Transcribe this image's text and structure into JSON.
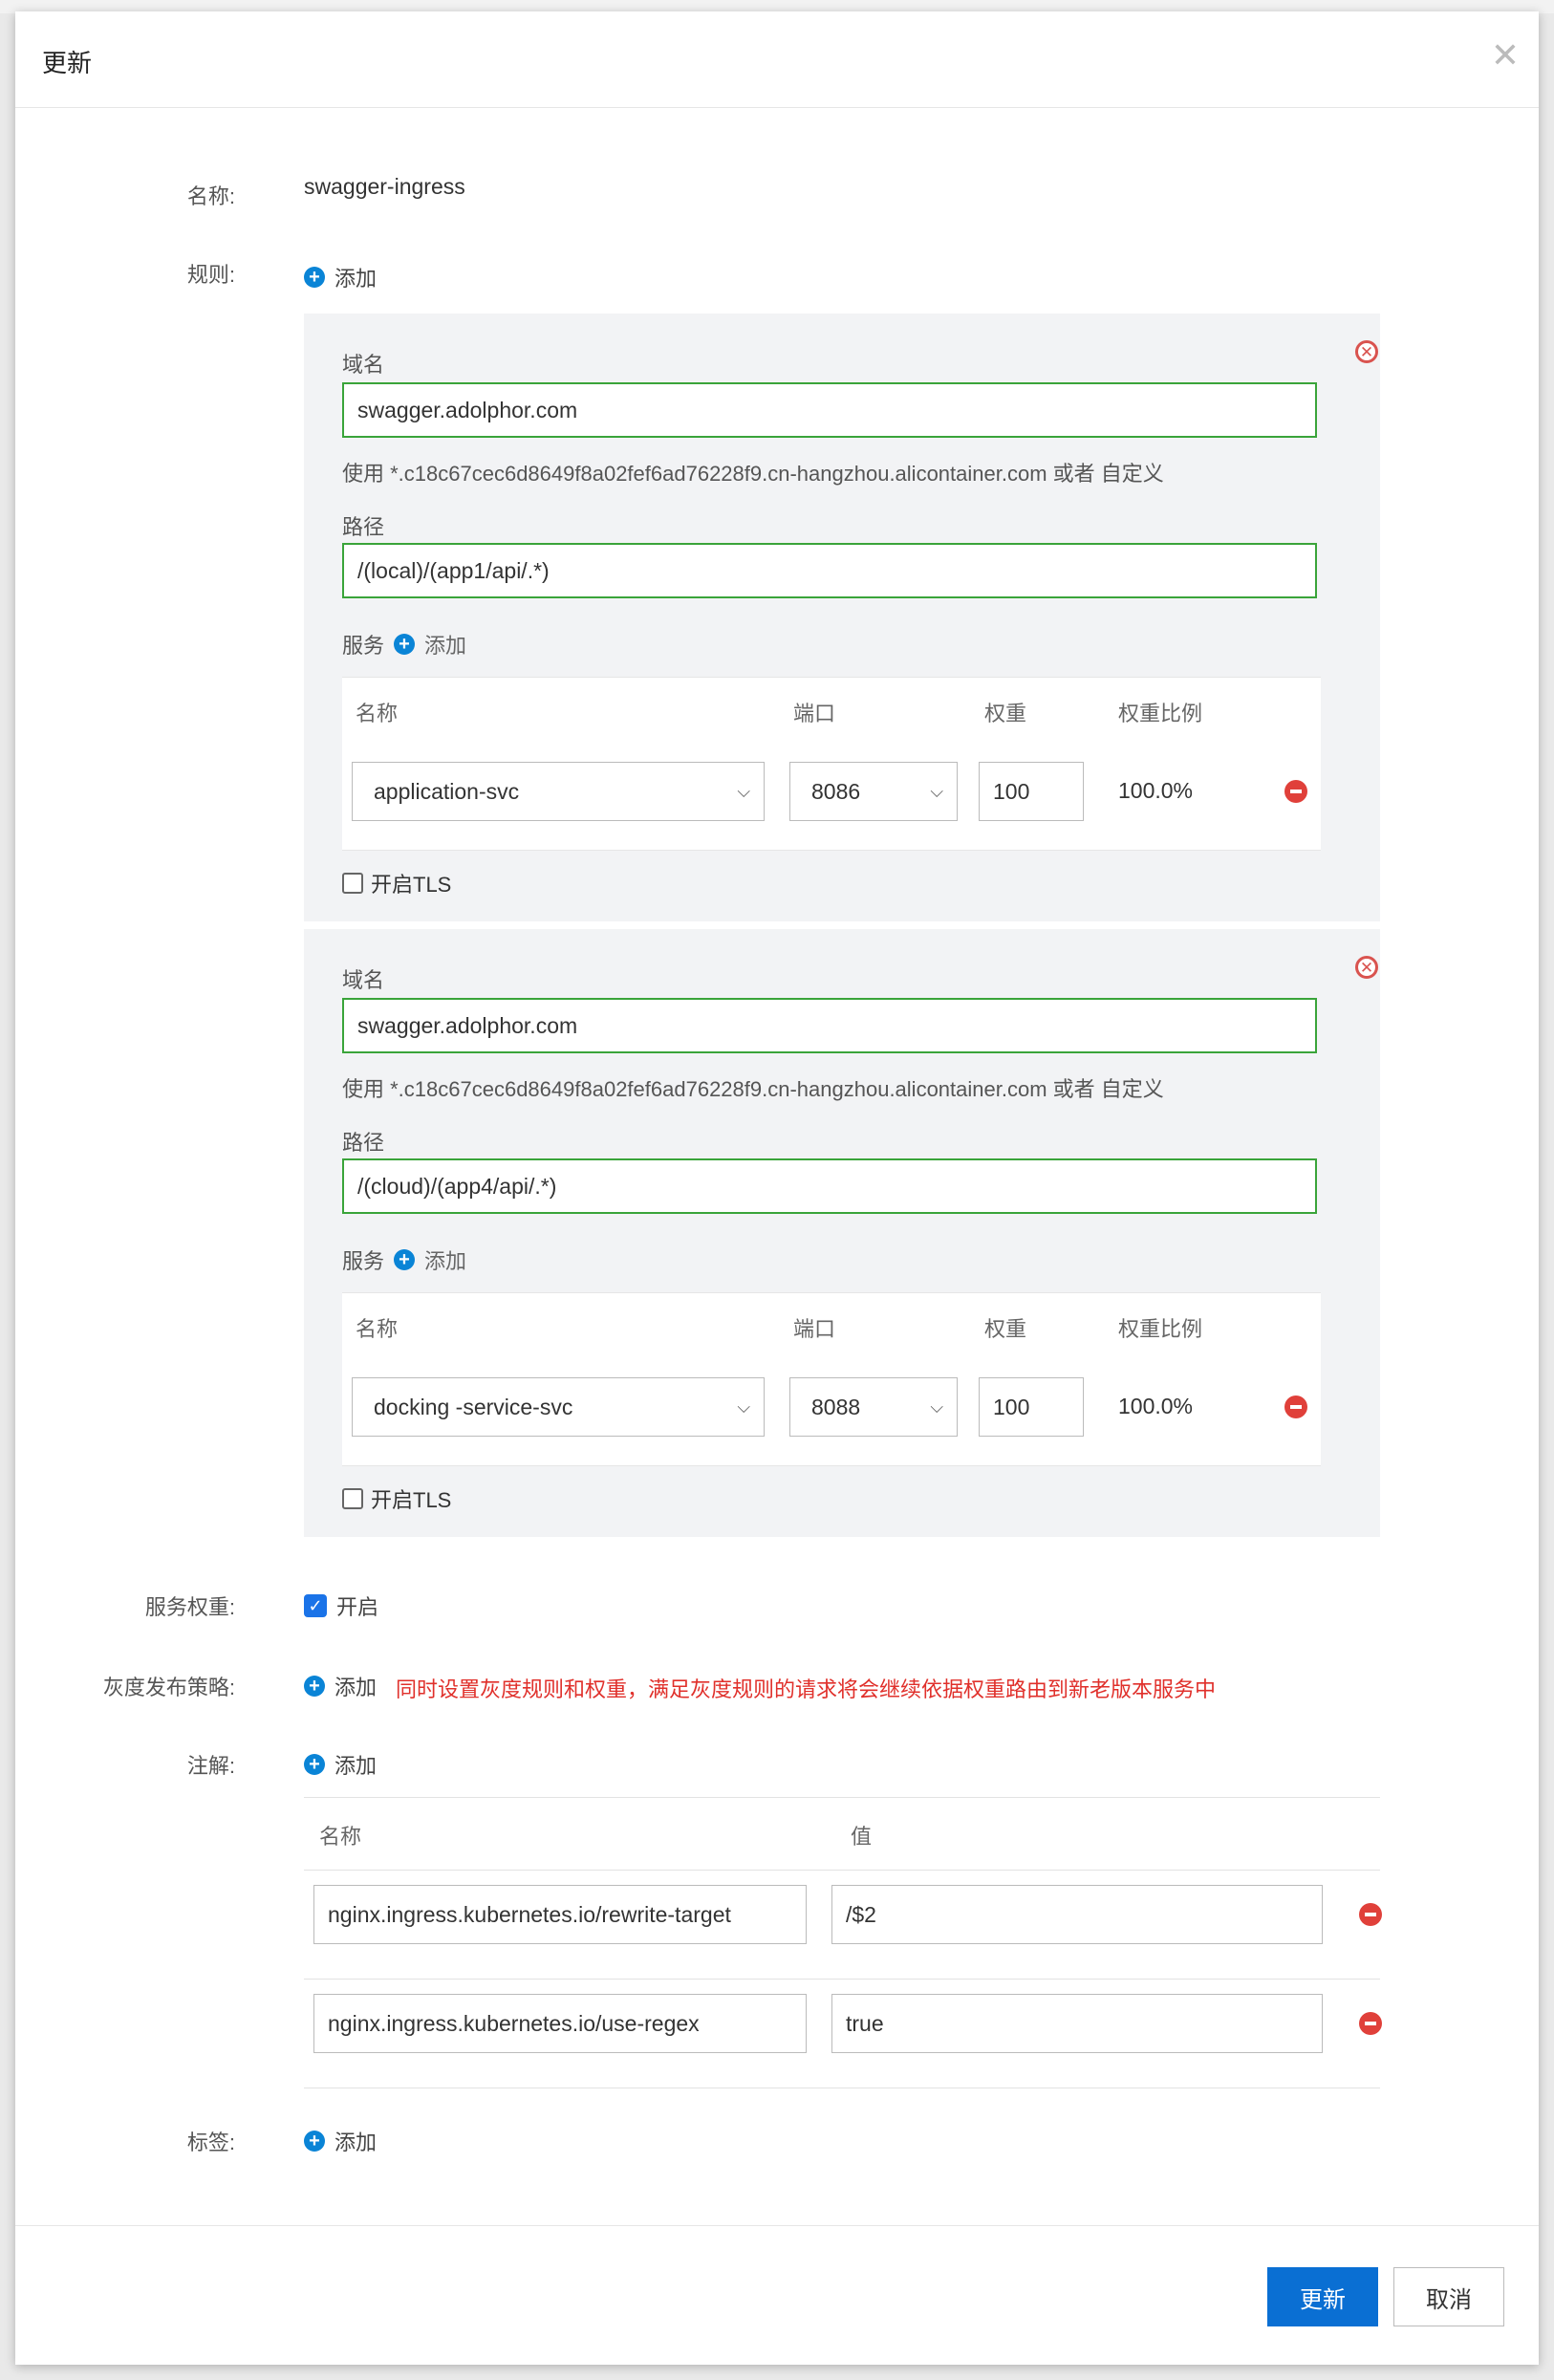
{
  "dialog": {
    "title": "更新",
    "close_glyph": "✕"
  },
  "labels": {
    "name": "名称:",
    "rules": "规则:",
    "service_weight": "服务权重:",
    "gray_release": "灰度发布策略:",
    "annotations": "注解:",
    "tags": "标签:"
  },
  "name_value": "swagger-ingress",
  "add_label": "添加",
  "rules": [
    {
      "domain_label": "域名",
      "domain": "swagger.adolphor.com",
      "hint": "使用 *.c18c67cec6d8649f8a02fef6ad76228f9.cn-hangzhou.alicontainer.com 或者 自定义",
      "path_label": "路径",
      "path": "/(local)/(app1/api/.*)",
      "service_label": "服务",
      "service_add": "添加",
      "table_headers": {
        "name": "名称",
        "port": "端口",
        "weight": "权重",
        "ratio": "权重比例"
      },
      "service": {
        "name": "application-svc",
        "port": "8086",
        "weight": "100",
        "ratio": "100.0%"
      },
      "tls_label": "开启TLS"
    },
    {
      "domain_label": "域名",
      "domain": "swagger.adolphor.com",
      "hint": "使用 *.c18c67cec6d8649f8a02fef6ad76228f9.cn-hangzhou.alicontainer.com 或者 自定义",
      "path_label": "路径",
      "path": "/(cloud)/(app4/api/.*)",
      "service_label": "服务",
      "service_add": "添加",
      "table_headers": {
        "name": "名称",
        "port": "端口",
        "weight": "权重",
        "ratio": "权重比例"
      },
      "service": {
        "name": "docking -service-svc",
        "port": "8088",
        "weight": "100",
        "ratio": "100.0%"
      },
      "tls_label": "开启TLS"
    }
  ],
  "service_weight": {
    "checked": true,
    "label": "开启"
  },
  "gray_release": {
    "add": "添加",
    "note": "同时设置灰度规则和权重，满足灰度规则的请求将会继续依据权重路由到新老版本服务中"
  },
  "annotations": {
    "headers": {
      "name": "名称",
      "value": "值"
    },
    "rows": [
      {
        "name": "nginx.ingress.kubernetes.io/rewrite-target",
        "value": "/$2"
      },
      {
        "name": "nginx.ingress.kubernetes.io/use-regex",
        "value": "true"
      }
    ]
  },
  "buttons": {
    "update": "更新",
    "cancel": "取消"
  },
  "colors": {
    "primary": "#0a6fd3",
    "valid_border": "#3aa43a",
    "danger": "#e0403a",
    "note_red": "#e0302b"
  }
}
